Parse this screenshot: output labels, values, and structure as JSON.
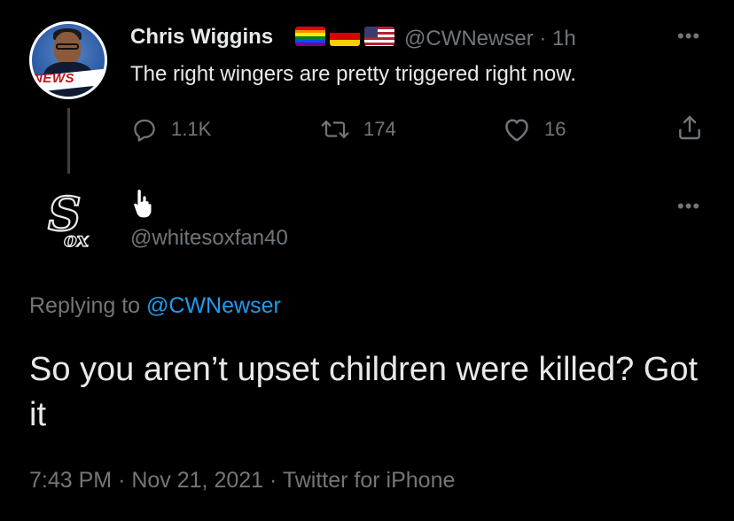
{
  "parent_tweet": {
    "author_name": "Chris Wiggins",
    "flags": [
      "rainbow-pride-flag",
      "germany-flag",
      "united-states-flag"
    ],
    "handle": "@CWNewser",
    "separator": "·",
    "time_ago": "1h",
    "avatar_banner_text": "NEWS",
    "text": "The right wingers are pretty triggered right now.",
    "actions": {
      "replies": "1.1K",
      "retweets": "174",
      "likes": "16"
    },
    "more_icon": "more-horizontal-icon"
  },
  "reply_tweet": {
    "handle": "@whitesoxfan40",
    "avatar_icon": "white-sox-logo",
    "replying_prefix": "Replying to",
    "replying_handle": "@CWNewser",
    "text": "So you aren’t upset children were killed? Got it",
    "time": "7:43 PM",
    "date": "Nov 21, 2021",
    "client": "Twitter for iPhone",
    "separator": "·",
    "more_icon": "more-horizontal-icon"
  },
  "colors": {
    "background": "#000000",
    "primary_text": "#e7e9ea",
    "secondary_text": "#71767b",
    "link": "#1d9bf0",
    "thread_line": "#3d4145"
  }
}
